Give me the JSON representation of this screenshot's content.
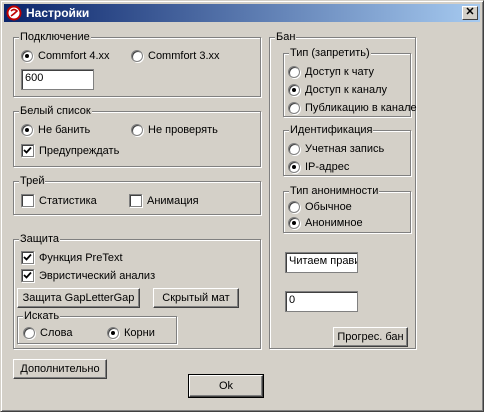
{
  "window": {
    "title": "Настройки",
    "close_glyph": "✕"
  },
  "connection": {
    "legend": "Подключение",
    "opt1": "Commfort 4.xx",
    "opt2": "Commfort 3.xx",
    "port": "600"
  },
  "whitelist": {
    "legend": "Белый список",
    "opt1": "Не банить",
    "opt2": "Не проверять",
    "warn": "Предупреждать"
  },
  "tray": {
    "legend": "Трей",
    "stats": "Статистика",
    "anim": "Анимация"
  },
  "protection": {
    "legend": "Защита",
    "pretext": "Функция  PreText",
    "heuristic": "Эвристический анализ",
    "gap_btn": "Защита GapLetterGap",
    "mat_btn": "Скрытый мат",
    "search": {
      "legend": "Искать",
      "opt1": "Слова",
      "opt2": "Корни"
    }
  },
  "more_button": "Дополнительно",
  "ok_button": "Ok",
  "ban": {
    "legend": "Бан",
    "type": {
      "legend": "Тип (запретить)",
      "opt1": "Доступ к чату",
      "opt2": "Доступ к каналу",
      "opt3": "Публикацию в канале"
    },
    "ident": {
      "legend": "Идентификация",
      "opt1": "Учетная запись",
      "opt2": "IP-адрес"
    },
    "anon": {
      "legend": "Тип анонимности",
      "opt1": "Обычное",
      "opt2": "Анонимное"
    },
    "reason": "Читаем прави",
    "count": "0",
    "progress_btn": "Прогрес. бан"
  },
  "colors": {
    "titlebar_start": "#0a246a",
    "titlebar_end": "#a6caf0",
    "face": "#d4d0c8"
  }
}
